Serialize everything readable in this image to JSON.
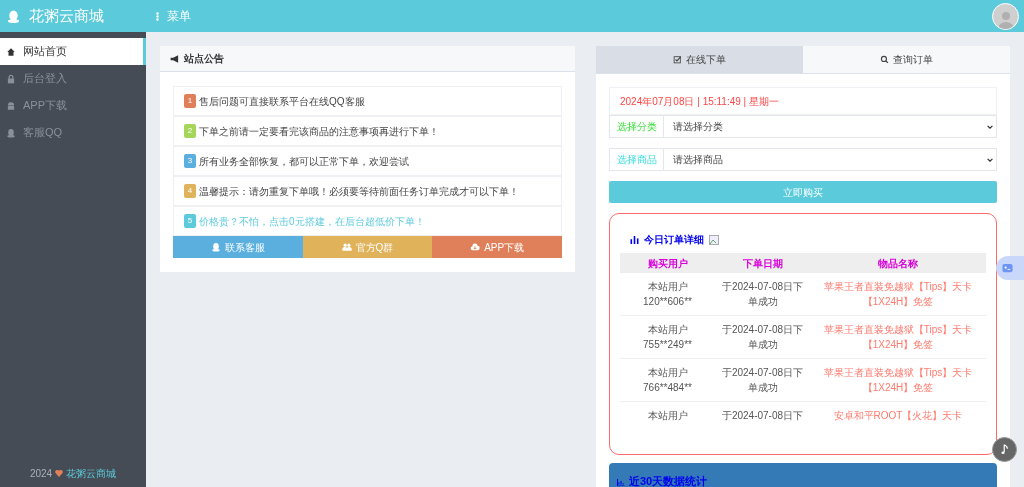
{
  "header": {
    "site_name": "花粥云商城",
    "menu_label": "菜单"
  },
  "sidebar": {
    "items": [
      {
        "label": "网站首页",
        "selected": true
      },
      {
        "label": "后台登入",
        "selected": false
      },
      {
        "label": "APP下载",
        "selected": false
      },
      {
        "label": "客服QQ",
        "selected": false
      }
    ],
    "footer": {
      "year": "2024",
      "site": "花粥云商城"
    }
  },
  "notice": {
    "title": "站点公告",
    "items": [
      {
        "num": "1",
        "text": "售后问题可直接联系平台在线QQ客服",
        "color": "#e0805a",
        "highlight": false
      },
      {
        "num": "2",
        "text": "下单之前请一定要看完该商品的注意事项再进行下单！",
        "color": "#a5d65a",
        "highlight": false
      },
      {
        "num": "3",
        "text": "所有业务全部恢复，都可以正常下单，欢迎尝试",
        "color": "#5aafde",
        "highlight": false
      },
      {
        "num": "4",
        "text": "温馨提示：请勿重复下单哦！必须要等待前面任务订单完成才可以下单！",
        "color": "#e0b25a",
        "highlight": false
      },
      {
        "num": "5",
        "text": "价格贵？不怕，点击0元搭建，在后台超低价下单！",
        "color": "#5bcbdc",
        "highlight": true
      }
    ],
    "buttons": [
      {
        "label": "联系客服",
        "color": "#5aafde"
      },
      {
        "label": "官方Q群",
        "color": "#e0b25a"
      },
      {
        "label": "APP下载",
        "color": "#e0805a"
      }
    ]
  },
  "order": {
    "tabs": [
      {
        "label": "在线下单",
        "selected": true
      },
      {
        "label": "查询订单",
        "selected": false
      }
    ],
    "datetime": "2024年07月08日 | 15:11:49 | 星期一",
    "selects": [
      {
        "label": "选择分类",
        "value": "请选择分类"
      },
      {
        "label": "选择商品",
        "value": "请选择商品"
      }
    ],
    "buy_button": "立即购买"
  },
  "today_orders": {
    "title": "今日订单详细",
    "columns": [
      "购买用户",
      "下单日期",
      "物品名称"
    ],
    "rows": [
      [
        "本站用户\n120**606**",
        "于2024-07-08日下单成功",
        "苹果王者直装免越狱【Tips】天卡【1X24H】免签"
      ],
      [
        "本站用户\n755**249**",
        "于2024-07-08日下单成功",
        "苹果王者直装免越狱【Tips】天卡【1X24H】免签"
      ],
      [
        "本站用户\n766**484**",
        "于2024-07-08日下单成功",
        "苹果王者直装免越狱【Tips】天卡【1X24H】免签"
      ],
      [
        "本站用户",
        "于2024-07-08日下",
        "安卓和平ROOT【火花】天卡"
      ]
    ]
  },
  "stats": {
    "title": "近30天数据统计"
  }
}
